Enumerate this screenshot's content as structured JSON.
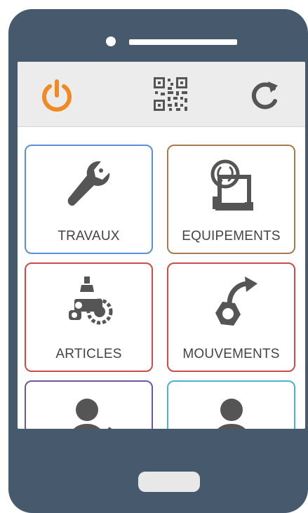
{
  "device": {
    "frame_color": "#46596d",
    "icons": [
      "camera-icon",
      "speaker-icon",
      "home-button"
    ]
  },
  "toolbar": {
    "icons": [
      "power-icon",
      "qr-code-icon",
      "refresh-icon"
    ],
    "power_color": "#f08a24",
    "icon_color": "#555555"
  },
  "tiles": [
    {
      "label": "TRAVAUX",
      "icon": "wrench-icon",
      "border_color": "#5b8fd6"
    },
    {
      "label": "EQUIPEMENTS",
      "icon": "equipment-icon",
      "border_color": "#a97a4c"
    },
    {
      "label": "ARTICLES",
      "icon": "parts-icon",
      "border_color": "#cf4b4b"
    },
    {
      "label": "MOUVEMENTS",
      "icon": "movement-icon",
      "border_color": "#cf4b4b"
    },
    {
      "label": "",
      "icon": "person-edit-icon",
      "border_color": "#6d56a8"
    },
    {
      "label": "",
      "icon": "person-icon",
      "border_color": "#4ab3cf"
    }
  ]
}
